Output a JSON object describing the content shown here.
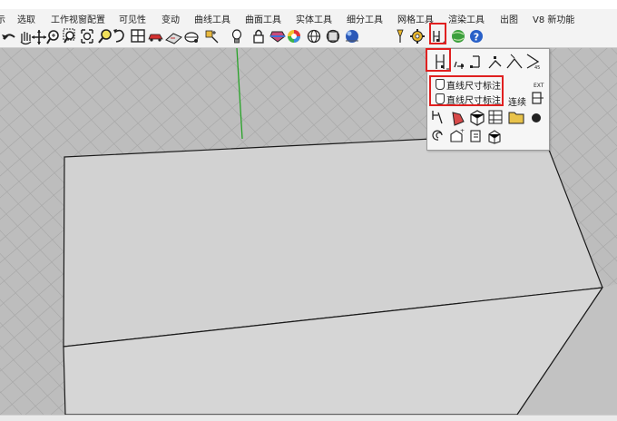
{
  "menubar": {
    "items": [
      {
        "label": "示"
      },
      {
        "label": "选取"
      },
      {
        "label": "工作视窗配置"
      },
      {
        "label": "可见性"
      },
      {
        "label": "变动"
      },
      {
        "label": "曲线工具"
      },
      {
        "label": "曲面工具"
      },
      {
        "label": "实体工具"
      },
      {
        "label": "细分工具"
      },
      {
        "label": "网格工具"
      },
      {
        "label": "渲染工具"
      },
      {
        "label": "出图"
      },
      {
        "label": "V8 新功能"
      }
    ]
  },
  "dimension_flyout": {
    "items": [
      {
        "label": "直线尺寸标注"
      },
      {
        "label": "直线尺寸标注:"
      }
    ],
    "continue_label": "连续",
    "ext_label": "EXT"
  },
  "colors": {
    "highlight": "#e02020",
    "viewport_bg": "#bdbdbd",
    "grid_line": "#a9a9a9",
    "y_axis": "#27a327",
    "x_axis": "#c23a3a",
    "box_top": "#d2d2d2",
    "box_side": "#c2c2c2",
    "box_front": "#d6d6d6"
  }
}
